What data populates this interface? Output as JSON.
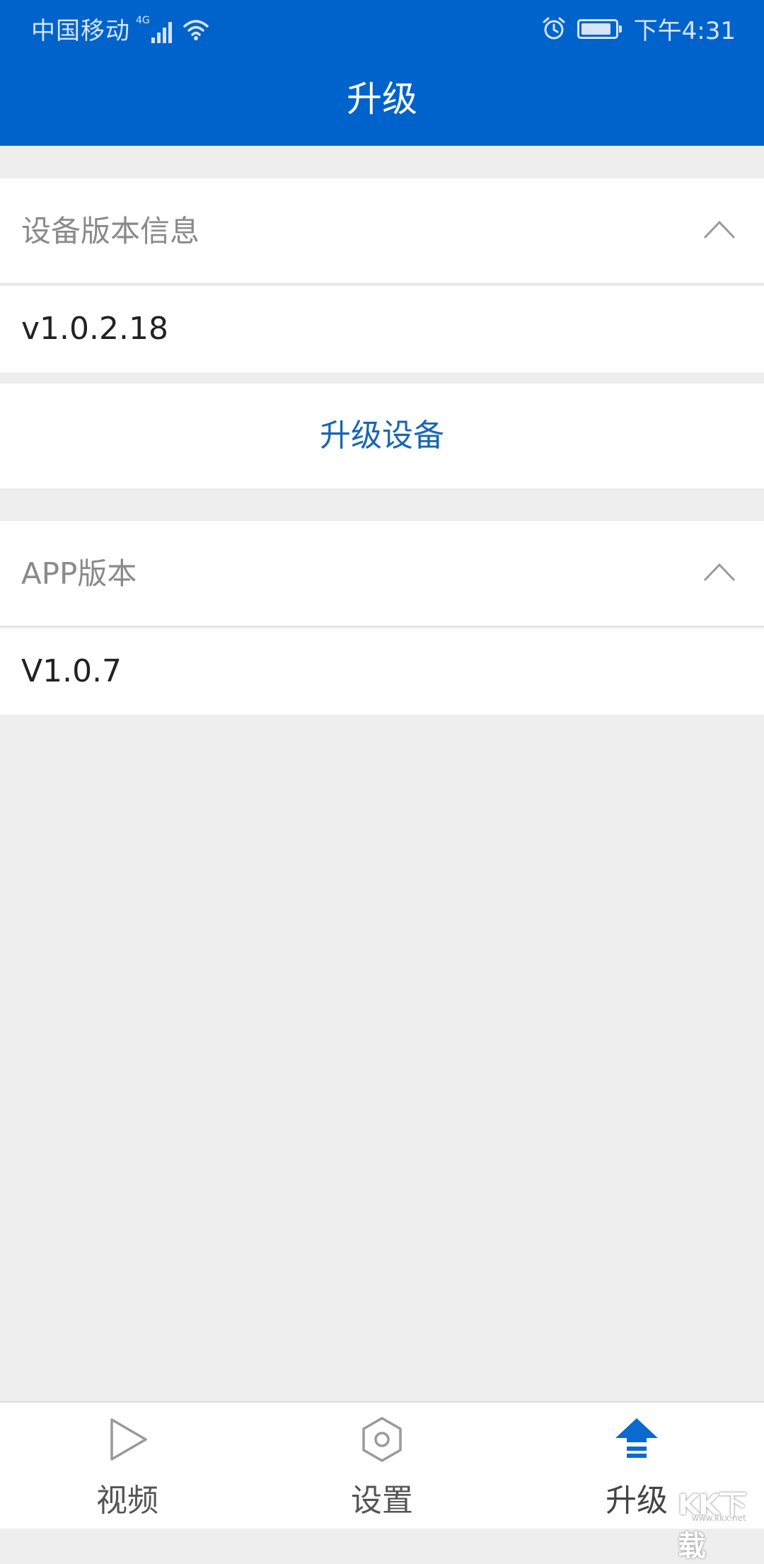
{
  "status_bar": {
    "carrier": "中国移动",
    "network": "4G",
    "time": "下午4:31"
  },
  "header": {
    "title": "升级"
  },
  "device_section": {
    "heading": "设备版本信息",
    "version": "v1.0.2.18",
    "action_label": "升级设备"
  },
  "app_section": {
    "heading": "APP版本",
    "version": "V1.0.7"
  },
  "tabbar": {
    "active": "upgrade",
    "items": [
      {
        "key": "video",
        "label": "视频",
        "icon": "play-icon"
      },
      {
        "key": "settings",
        "label": "设置",
        "icon": "hexagon-settings-icon"
      },
      {
        "key": "upgrade",
        "label": "升级",
        "icon": "upload-arrow-icon"
      }
    ]
  },
  "watermark": {
    "logo_text": "KK下载",
    "url": "www.kkx.net"
  },
  "colors": {
    "header_bg": "#0063cb",
    "accent": "#1966b2",
    "page_bg": "#eeeeee"
  }
}
